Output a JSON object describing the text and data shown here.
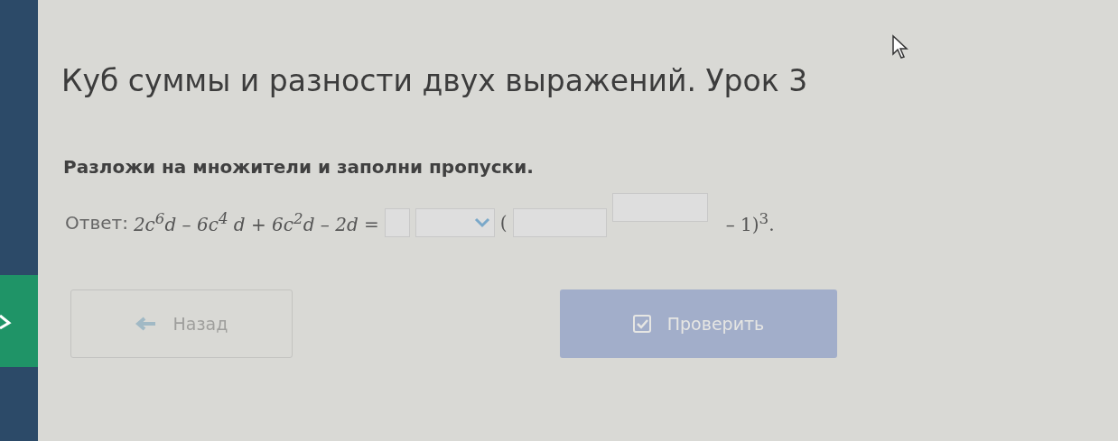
{
  "title": "Куб суммы и разности двух выражений. Урок 3",
  "instruction": "Разложи на множители и заполни пропуски.",
  "answer": {
    "label": "Ответ:",
    "parts": [
      {
        "kind": "text",
        "text": "2c$^{6}$d – 6c$^{4}$ d + 6c$^{2}$d – 2d ="
      },
      {
        "kind": "input"
      },
      {
        "kind": "select"
      },
      {
        "kind": "text",
        "text": "("
      },
      {
        "kind": "input"
      },
      {
        "kind": "raised_input"
      },
      {
        "kind": "text",
        "text": "– 1)$^{3}$."
      }
    ]
  },
  "buttons": [
    {
      "kind": "back",
      "label": "Назад",
      "disabled": true
    },
    {
      "kind": "check",
      "label": "Проверить",
      "disabled": true
    }
  ]
}
